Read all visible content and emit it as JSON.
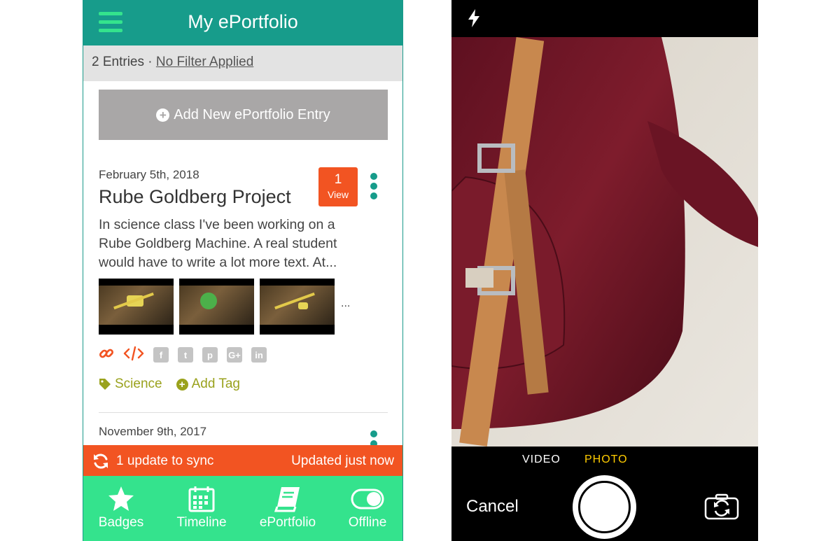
{
  "portfolio": {
    "title": "My ePortfolio",
    "filter": {
      "count": "2 Entries",
      "separator": "·",
      "link": "No Filter Applied"
    },
    "add_button": "Add New ePortfolio Entry",
    "entries": [
      {
        "date": "February 5th, 2018",
        "title": "Rube Goldberg Project",
        "views_count": "1",
        "views_label": "View",
        "description": "In science class I've been working on a Rube Goldberg Machine. A real student would have to write a lot more text. At...",
        "more": "...",
        "tag": "Science",
        "add_tag": "Add Tag"
      },
      {
        "date": "November 9th, 2017"
      }
    ],
    "share_icons": [
      "link-icon",
      "embed-icon",
      "facebook-icon",
      "twitter-icon",
      "pinterest-icon",
      "google-plus-icon",
      "linkedin-icon"
    ],
    "sync": {
      "status": "1 update to sync",
      "updated": "Updated just now"
    },
    "tabs": [
      "Badges",
      "Timeline",
      "ePortfolio",
      "Offline"
    ],
    "colors": {
      "header": "#179c8b",
      "accent_green": "#34e38d",
      "alert": "#f25422",
      "tag": "#9aa21d"
    }
  },
  "camera": {
    "modes": [
      "VIDEO",
      "PHOTO"
    ],
    "selected_mode": "PHOTO",
    "cancel": "Cancel",
    "icons": [
      "flash-icon",
      "shutter-button",
      "camera-flip-icon"
    ],
    "colors": {
      "active_mode": "#ffcc00"
    }
  }
}
